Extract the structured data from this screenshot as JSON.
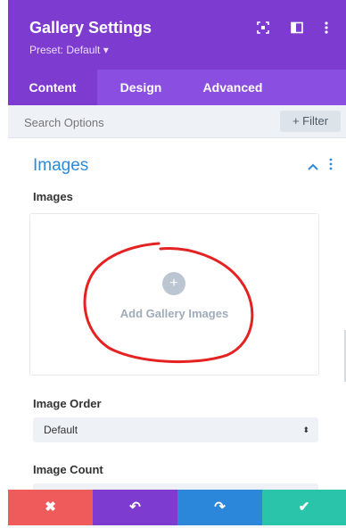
{
  "header": {
    "title": "Gallery Settings",
    "preset": "Preset: Default ▾",
    "icons": [
      "expand-icon",
      "sidebar-toggle-icon",
      "more-options-icon"
    ]
  },
  "tabs": [
    {
      "label": "Content",
      "active": true
    },
    {
      "label": "Design",
      "active": false
    },
    {
      "label": "Advanced",
      "active": false
    }
  ],
  "search": {
    "placeholder": "Search Options",
    "filter_label": "+ Filter"
  },
  "section": {
    "title": "Images",
    "collapse_icon": "chevron-up-icon",
    "menu_icon": "more-options-icon"
  },
  "images_field": {
    "label": "Images",
    "add_label": "Add Gallery Images"
  },
  "image_order": {
    "label": "Image Order",
    "value": "Default"
  },
  "image_count": {
    "label": "Image Count"
  },
  "footer": {
    "buttons": [
      {
        "name": "cancel",
        "icon": "close-icon",
        "glyph": "✖",
        "color": "#ef5a5a"
      },
      {
        "name": "undo",
        "icon": "undo-icon",
        "glyph": "↶",
        "color": "#7e3bd0"
      },
      {
        "name": "redo",
        "icon": "redo-icon",
        "glyph": "↷",
        "color": "#2b87da"
      },
      {
        "name": "save",
        "icon": "check-icon",
        "glyph": "✔",
        "color": "#29c4a9"
      }
    ]
  },
  "colors": {
    "header": "#7e3bd0",
    "tabs": "#8a4fe0",
    "accent": "#2e8ad8",
    "annotation": "#e52222"
  }
}
